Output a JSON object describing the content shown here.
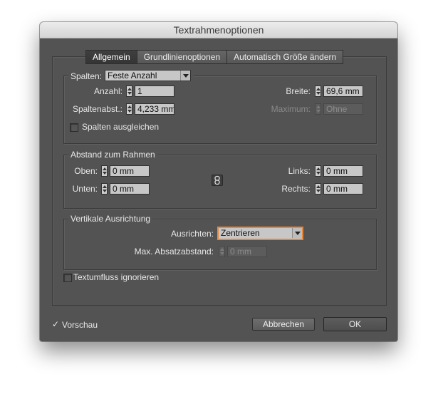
{
  "window": {
    "title": "Textrahmenoptionen"
  },
  "tabs": [
    {
      "label": "Allgemein",
      "active": true
    },
    {
      "label": "Grundlinienoptionen",
      "active": false
    },
    {
      "label": "Automatisch Größe ändern",
      "active": false
    }
  ],
  "columns": {
    "legend_label": "Spalten:",
    "type_value": "Feste Anzahl",
    "count_label": "Anzahl:",
    "count_value": "1",
    "gutter_label": "Spaltenabst.:",
    "gutter_value": "4,233 mm",
    "width_label": "Breite:",
    "width_value": "69,6 mm",
    "maximum_label": "Maximum:",
    "maximum_value": "Ohne",
    "balance_label": "Spalten ausgleichen",
    "balance_checked": false
  },
  "inset": {
    "legend": "Abstand zum Rahmen",
    "top_label": "Oben:",
    "top_value": "0 mm",
    "bottom_label": "Unten:",
    "bottom_value": "0 mm",
    "left_label": "Links:",
    "left_value": "0 mm",
    "right_label": "Rechts:",
    "right_value": "0 mm"
  },
  "vertical": {
    "legend": "Vertikale Ausrichtung",
    "align_label": "Ausrichten:",
    "align_value": "Zentrieren",
    "max_spacing_label": "Max. Absatzabstand:",
    "max_spacing_value": "0 mm"
  },
  "ignore_wrap": {
    "label": "Textumfluss ignorieren",
    "checked": false
  },
  "footer": {
    "preview_label": "Vorschau",
    "preview_checked": true,
    "cancel_label": "Abbrechen",
    "ok_label": "OK"
  },
  "colors": {
    "dialog_bg": "#535353",
    "focus_ring": "#e8883a"
  }
}
